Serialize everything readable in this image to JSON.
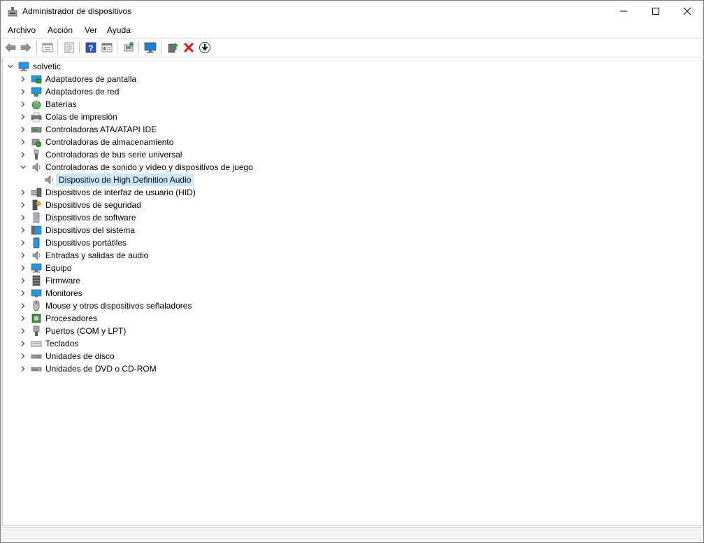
{
  "window": {
    "title": "Administrador de dispositivos"
  },
  "menu": {
    "items": [
      "Archivo",
      "Acción",
      "Ver",
      "Ayuda"
    ]
  },
  "toolbar": {
    "icons": [
      "back-arrow-icon",
      "forward-arrow-icon",
      "properties-view-icon",
      "list-view-icon",
      "help-icon",
      "tree-view-icon",
      "scan-hardware-icon",
      "computer-monitor-icon",
      "update-driver-icon",
      "uninstall-x-icon",
      "download-circle-icon"
    ]
  },
  "tree": {
    "root": "solvetic",
    "categories": [
      {
        "label": "Adaptadores de pantalla",
        "icon": "display-adapter-icon"
      },
      {
        "label": "Adaptadores de red",
        "icon": "network-adapter-icon"
      },
      {
        "label": "Baterías",
        "icon": "battery-icon"
      },
      {
        "label": "Colas de impresión",
        "icon": "printer-icon"
      },
      {
        "label": "Controladoras ATA/ATAPI IDE",
        "icon": "ide-controller-icon"
      },
      {
        "label": "Controladoras de almacenamiento",
        "icon": "storage-controller-icon"
      },
      {
        "label": "Controladoras de bus serie universal",
        "icon": "usb-icon"
      },
      {
        "label": "Controladoras de sonido y vídeo y dispositivos de juego",
        "icon": "speaker-icon",
        "expanded": true,
        "children": [
          {
            "label": "Dispositivo de High Definition Audio",
            "icon": "speaker-icon",
            "selected": true
          }
        ]
      },
      {
        "label": "Dispositivos de interfaz de usuario (HID)",
        "icon": "hid-icon"
      },
      {
        "label": "Dispositivos de seguridad",
        "icon": "security-key-icon"
      },
      {
        "label": "Dispositivos de software",
        "icon": "software-device-icon"
      },
      {
        "label": "Dispositivos del sistema",
        "icon": "system-device-icon"
      },
      {
        "label": "Dispositivos portátiles",
        "icon": "portable-device-icon"
      },
      {
        "label": "Entradas y salidas de audio",
        "icon": "speaker-icon"
      },
      {
        "label": "Equipo",
        "icon": "computer-icon"
      },
      {
        "label": "Firmware",
        "icon": "firmware-icon"
      },
      {
        "label": "Monitores",
        "icon": "monitor-icon"
      },
      {
        "label": "Mouse y otros dispositivos señaladores",
        "icon": "mouse-icon"
      },
      {
        "label": "Procesadores",
        "icon": "processor-icon"
      },
      {
        "label": "Puertos (COM y LPT)",
        "icon": "port-icon"
      },
      {
        "label": "Teclados",
        "icon": "keyboard-icon"
      },
      {
        "label": "Unidades de disco",
        "icon": "disk-drive-icon"
      },
      {
        "label": "Unidades de DVD o CD-ROM",
        "icon": "dvd-drive-icon"
      }
    ]
  },
  "colors": {
    "selection": "#cce8ff",
    "accent": "#0078d4"
  }
}
